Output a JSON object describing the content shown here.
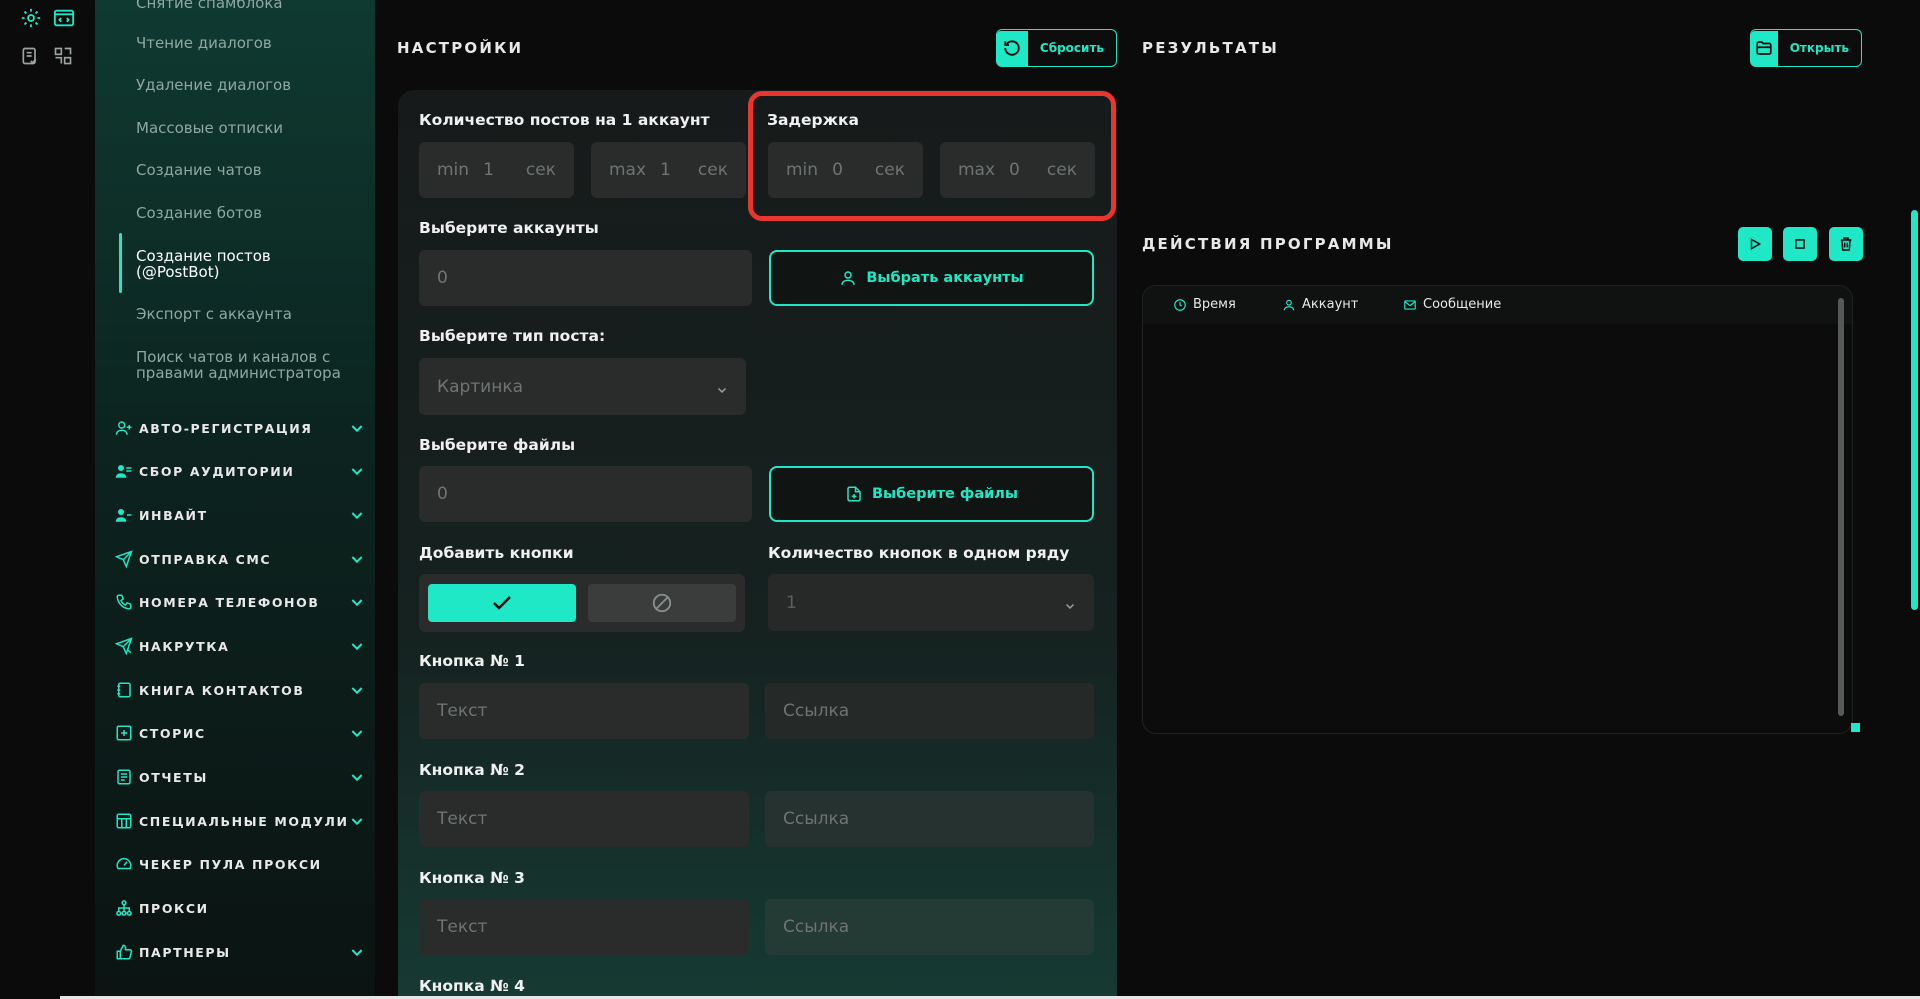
{
  "sidebar": {
    "sub_items": [
      {
        "label": "Снятие спамблока"
      },
      {
        "label": "Чтение диалогов"
      },
      {
        "label": "Удаление диалогов"
      },
      {
        "label": "Массовые отписки"
      },
      {
        "label": "Создание чатов"
      },
      {
        "label": "Создание ботов"
      },
      {
        "label": "Создание постов (@PostBot)"
      },
      {
        "label": "Экспорт с аккаунта"
      },
      {
        "label": "Поиск чатов и каналов с правами администратора"
      }
    ],
    "categories": [
      {
        "label": "АВТО-РЕГИСТРАЦИЯ",
        "icon": "user-plus-icon"
      },
      {
        "label": "СБОР АУДИТОРИИ",
        "icon": "users-icon"
      },
      {
        "label": "ИНВАЙТ",
        "icon": "user-add-icon"
      },
      {
        "label": "ОТПРАВКА СМС",
        "icon": "send-icon"
      },
      {
        "label": "НОМЕРА ТЕЛЕФОНОВ",
        "icon": "phone-icon"
      },
      {
        "label": "НАКРУТКА",
        "icon": "boost-icon"
      },
      {
        "label": "КНИГА КОНТАКТОВ",
        "icon": "contacts-book-icon"
      },
      {
        "label": "СТОРИС",
        "icon": "stories-icon"
      },
      {
        "label": "ОТЧЕТЫ",
        "icon": "report-icon"
      },
      {
        "label": "СПЕЦИАЛЬНЫЕ МОДУЛИ",
        "icon": "modules-icon"
      },
      {
        "label": "ЧЕКЕР ПУЛА ПРОКСИ",
        "icon": "gauge-icon"
      },
      {
        "label": "ПРОКСИ",
        "icon": "network-icon"
      },
      {
        "label": "ПАРТНЕРЫ",
        "icon": "thumbs-up-icon"
      }
    ]
  },
  "settings": {
    "title": "НАСТРОЙКИ",
    "reset_label": "Сбросить",
    "posts_per_account_label": "Количество постов на 1 аккаунт",
    "posts_min": {
      "prefix": "min",
      "value": "1",
      "suffix": "сек"
    },
    "posts_max": {
      "prefix": "max",
      "value": "1",
      "suffix": "сек"
    },
    "delay_label": "Задержка",
    "delay_min": {
      "prefix": "min",
      "value": "0",
      "suffix": "сек"
    },
    "delay_max": {
      "prefix": "max",
      "value": "0",
      "suffix": "сек"
    },
    "accounts_label": "Выберите аккаунты",
    "accounts_value": "0",
    "select_accounts_button": "Выбрать аккаунты",
    "post_type_label": "Выберите тип поста:",
    "post_type_value": "Картинка",
    "files_label": "Выберите файлы",
    "files_value": "0",
    "select_files_button": "Выберите файлы",
    "add_buttons_label": "Добавить кнопки",
    "buttons_per_row_label": "Количество кнопок в одном ряду",
    "buttons_per_row_value": "1",
    "button_groups": [
      {
        "label": "Кнопка № 1",
        "text_placeholder": "Текст",
        "link_placeholder": "Ссылка"
      },
      {
        "label": "Кнопка № 2",
        "text_placeholder": "Текст",
        "link_placeholder": "Ссылка"
      },
      {
        "label": "Кнопка № 3",
        "text_placeholder": "Текст",
        "link_placeholder": "Ссылка"
      },
      {
        "label": "Кнопка № 4"
      }
    ]
  },
  "results": {
    "title": "РЕЗУЛЬТАТЫ",
    "open_label": "Открыть"
  },
  "actions": {
    "title": "ДЕЙСТВИЯ ПРОГРАММЫ",
    "columns": [
      "Время",
      "Аккаунт",
      "Сообщение"
    ]
  },
  "colors": {
    "accent": "#1ee8c5",
    "highlight": "#e8352d",
    "background": "#0b0b0b"
  }
}
